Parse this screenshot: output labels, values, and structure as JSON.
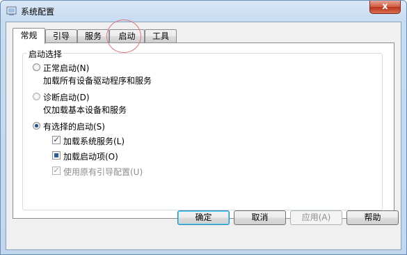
{
  "window": {
    "title": "系统配置",
    "close_glyph": "x"
  },
  "tabs": [
    {
      "label": "常规",
      "active": true
    },
    {
      "label": "引导",
      "active": false
    },
    {
      "label": "服务",
      "active": false
    },
    {
      "label": "启动",
      "active": false
    },
    {
      "label": "工具",
      "active": false
    }
  ],
  "startup": {
    "group_title": "启动选择",
    "normal": {
      "label": "正常启动(N)",
      "desc": "加载所有设备驱动程序和服务",
      "checked": false
    },
    "diagnostic": {
      "label": "诊断启动(D)",
      "desc": "仅加载基本设备和服务",
      "checked": false
    },
    "selective": {
      "label": "有选择的启动(S)",
      "checked": true,
      "load_services": {
        "label": "加载系统服务(L)",
        "state": "checked"
      },
      "load_startup": {
        "label": "加载启动项(O)",
        "state": "indeterminate"
      },
      "use_original_boot": {
        "label": "使用原有引导配置(U)",
        "state": "checked-disabled"
      }
    }
  },
  "buttons": {
    "ok": "确定",
    "cancel": "取消",
    "apply": "应用(A)",
    "help": "帮助"
  },
  "colors": {
    "title_bar": "#c7dbf1",
    "close_button": "#cf5a3f",
    "annotation_circle": "#e0737a"
  },
  "icons": {
    "app": "msconfig-icon",
    "check": "✓"
  }
}
